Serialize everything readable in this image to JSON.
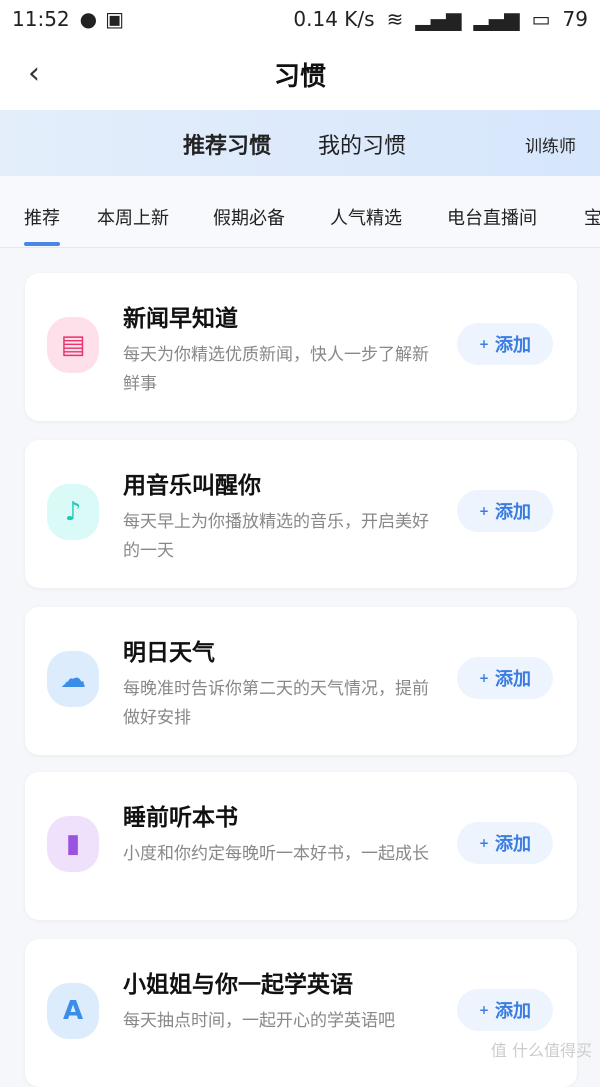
{
  "status": {
    "time": "11:52",
    "speed": "0.14 K/s",
    "battery": "79"
  },
  "nav": {
    "title": "习惯"
  },
  "banner": {
    "tabs": [
      "推荐习惯",
      "我的习惯"
    ],
    "trainer": "训练师"
  },
  "tabs": [
    "推荐",
    "本周上新",
    "假期必备",
    "人气精选",
    "电台直播间",
    "宝"
  ],
  "cards": [
    {
      "title": "新闻早知道",
      "desc": "每天为你精选优质新闻，快人一步了解新鲜事",
      "icon": "news-icon",
      "color": "#e8336d",
      "bg": "#fde0ea"
    },
    {
      "title": "用音乐叫醒你",
      "desc": "每天早上为你播放精选的音乐，开启美好的一天",
      "icon": "music-alarm-icon",
      "color": "#1fc7b8",
      "bg": "#d9faf7"
    },
    {
      "title": "明日天气",
      "desc": "每晚准时告诉你第二天的天气情况，提前做好安排",
      "icon": "weather-icon",
      "color": "#3b8ee8",
      "bg": "#dcecfd"
    },
    {
      "title": "睡前听本书",
      "desc": "小度和你约定每晚听一本好书，一起成长",
      "icon": "book-icon",
      "color": "#9a52e0",
      "bg": "#efe0fb"
    },
    {
      "title": "小姐姐与你一起学英语",
      "desc": "每天抽点时间，一起开心的学英语吧",
      "icon": "english-icon",
      "color": "#3b8ee8",
      "bg": "#dcecfd"
    }
  ],
  "add_label": "添加",
  "watermark": "值 什么值得买"
}
